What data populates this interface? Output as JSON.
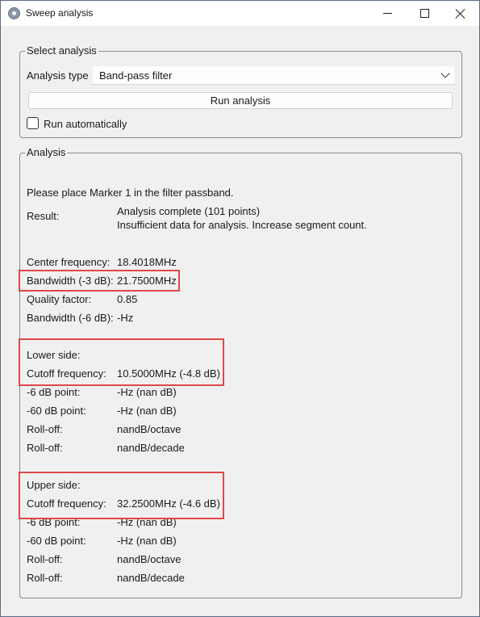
{
  "window": {
    "title": "Sweep analysis"
  },
  "select_group": {
    "legend": "Select analysis",
    "analysis_type_label": "Analysis type",
    "analysis_type_value": "Band-pass filter",
    "run_button": "Run analysis",
    "auto_label": "Run automatically",
    "auto_checked": false
  },
  "analysis_group": {
    "legend": "Analysis",
    "instruction": "Please place Marker 1 in the filter passband.",
    "result_label": "Result:",
    "result_line1": "Analysis complete (101 points)",
    "result_line2": "Insufficient data for analysis. Increase segment count.",
    "center_frequency_label": "Center frequency:",
    "center_frequency_value": "18.4018MHz",
    "bandwidth_3db_label": "Bandwidth (-3 dB):",
    "bandwidth_3db_value": "21.7500MHz",
    "quality_factor_label": "Quality factor:",
    "quality_factor_value": "0.85",
    "bandwidth_6db_label": "Bandwidth (-6 dB):",
    "bandwidth_6db_value": "-Hz",
    "lower": {
      "heading": "Lower side:",
      "cutoff_label": "Cutoff frequency:",
      "cutoff_value": "10.5000MHz (-4.8 dB)",
      "p6_label": "-6 dB point:",
      "p6_value": "-Hz (nan dB)",
      "p60_label": "-60 dB point:",
      "p60_value": "-Hz (nan dB)",
      "rolloff_oct_label": "Roll-off:",
      "rolloff_oct_value": "nandB/octave",
      "rolloff_dec_label": "Roll-off:",
      "rolloff_dec_value": "nandB/decade"
    },
    "upper": {
      "heading": "Upper side:",
      "cutoff_label": "Cutoff frequency:",
      "cutoff_value": "32.2500MHz (-4.6 dB)",
      "p6_label": "-6 dB point:",
      "p6_value": "-Hz (nan dB)",
      "p60_label": "-60 dB point:",
      "p60_value": "-Hz (nan dB)",
      "rolloff_oct_label": "Roll-off:",
      "rolloff_oct_value": "nandB/octave",
      "rolloff_dec_label": "Roll-off:",
      "rolloff_dec_value": "nandB/decade"
    }
  },
  "icons": {
    "app": "app-icon",
    "minimize": "minimize-icon",
    "maximize": "maximize-icon",
    "close": "close-icon",
    "dropdown": "chevron-down-icon"
  },
  "colors": {
    "highlight": "#e04848",
    "background": "#f0f0f0"
  }
}
